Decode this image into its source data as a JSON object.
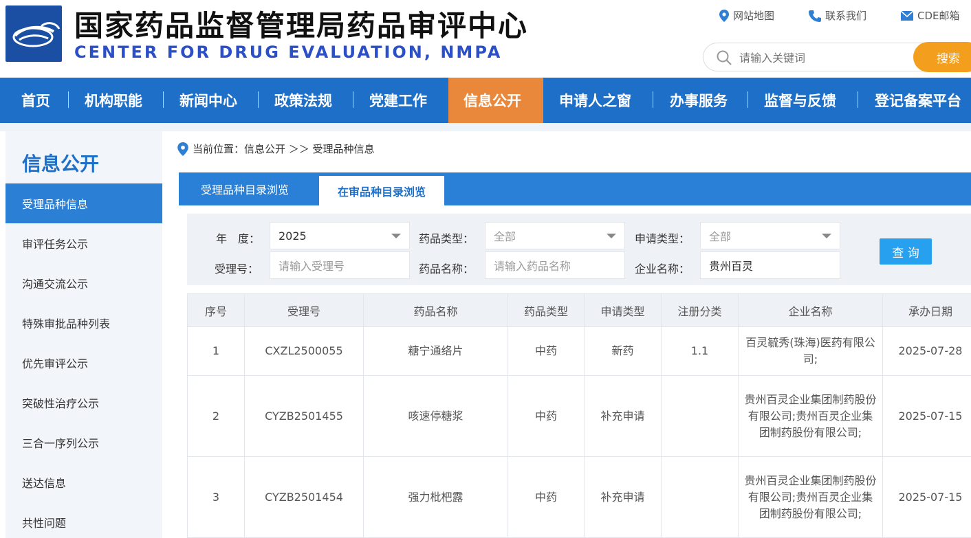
{
  "header": {
    "title": "国家药品监督管理局药品审评中心",
    "subtitle": "CENTER FOR DRUG EVALUATION, NMPA",
    "links": [
      {
        "label": "网站地图",
        "icon": "location-pin-icon"
      },
      {
        "label": "联系我们",
        "icon": "phone-icon"
      },
      {
        "label": "CDE邮箱",
        "icon": "mail-icon"
      }
    ],
    "search": {
      "placeholder": "请输入关键词",
      "button": "搜索"
    }
  },
  "nav": {
    "items": [
      "首页",
      "机构职能",
      "新闻中心",
      "政策法规",
      "党建工作",
      "信息公开",
      "申请人之窗",
      "办事服务",
      "监督与反馈",
      "登记备案平台"
    ],
    "active": "信息公开"
  },
  "sidebar": {
    "title": "信息公开",
    "items": [
      "受理品种信息",
      "审评任务公示",
      "沟通交流公示",
      "特殊审批品种列表",
      "优先审评公示",
      "突破性治疗公示",
      "三合一序列公示",
      "送达信息",
      "共性问题"
    ],
    "active": "受理品种信息"
  },
  "breadcrumb": {
    "text": "当前位置：信息公开 ＞＞ 受理品种信息"
  },
  "tabs": [
    "受理品种目录浏览",
    "在审品种目录浏览"
  ],
  "filter": {
    "year_label": "年　度：",
    "year_value": "2025",
    "drug_type_label": "药品类型：",
    "drug_type_value": "全部",
    "apply_type_label": "申请类型：",
    "apply_type_value": "全部",
    "accept_no_label": "受理号：",
    "accept_no_placeholder": "请输入受理号",
    "drug_name_label": "药品名称：",
    "drug_name_placeholder": "请输入药品名称",
    "company_label": "企业名称：",
    "company_value": "贵州百灵",
    "query_button": "查 询"
  },
  "table": {
    "headers": [
      "序号",
      "受理号",
      "药品名称",
      "药品类型",
      "申请类型",
      "注册分类",
      "企业名称",
      "承办日期"
    ],
    "rows": [
      {
        "no": "1",
        "accept_no": "CXZL2500055",
        "drug_name": "糖宁通络片",
        "drug_type": "中药",
        "apply_type": "新药",
        "reg_class": "1.1",
        "company": "百灵毓秀(珠海)医药有限公司;",
        "date": "2025-07-28"
      },
      {
        "no": "2",
        "accept_no": "CYZB2501455",
        "drug_name": "咳速停糖浆",
        "drug_type": "中药",
        "apply_type": "补充申请",
        "reg_class": "",
        "company": "贵州百灵企业集团制药股份有限公司;贵州百灵企业集团制药股份有限公司;",
        "date": "2025-07-15"
      },
      {
        "no": "3",
        "accept_no": "CYZB2501454",
        "drug_name": "强力枇杷露",
        "drug_type": "中药",
        "apply_type": "补充申请",
        "reg_class": "",
        "company": "贵州百灵企业集团制药股份有限公司;贵州百灵企业集团制药股份有限公司;",
        "date": "2025-07-15"
      }
    ]
  },
  "colors": {
    "brand_blue": "#1e6fc8",
    "active_orange": "#e9883a",
    "search_orange": "#f39f1d",
    "query_blue": "#27a0f0"
  }
}
